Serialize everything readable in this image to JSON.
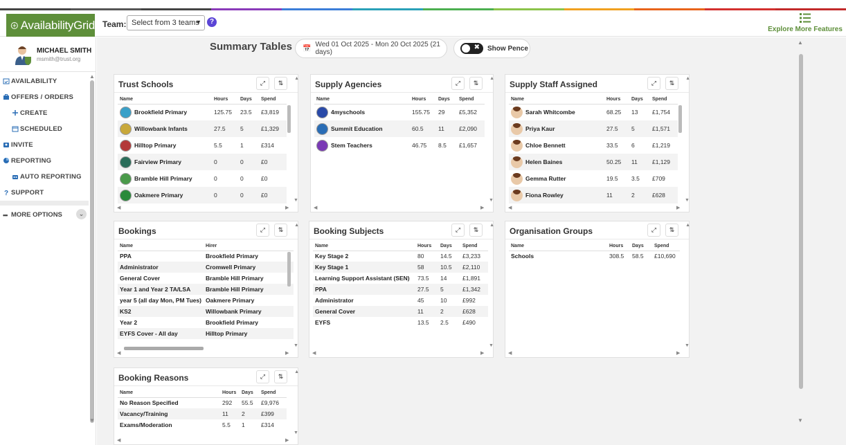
{
  "app": {
    "name": "AvailabilityGrid",
    "rainbow": [
      "#444",
      "#555",
      "#444",
      "#8a3ab9",
      "#3b7dd8",
      "#2aa0b8",
      "#4caf50",
      "#8bc34a",
      "#f0a020",
      "#e8641b",
      "#d3302e",
      "#c22a2a"
    ]
  },
  "header": {
    "team_label": "Team:",
    "team_select": "Select from 3 teams",
    "help": "?",
    "explore": "Explore More Features"
  },
  "user": {
    "name": "MICHAEL SMITH",
    "email": "msmith@trust.org"
  },
  "nav": [
    {
      "label": "AVAILABILITY",
      "icon": "calendar-check-icon",
      "sub": false
    },
    {
      "label": "OFFERS / ORDERS",
      "icon": "briefcase-icon",
      "sub": false
    },
    {
      "label": "CREATE",
      "icon": "plus-icon",
      "sub": true
    },
    {
      "label": "SCHEDULED",
      "icon": "calendar-icon",
      "sub": true
    },
    {
      "label": "INVITE",
      "icon": "invite-icon",
      "sub": false
    },
    {
      "label": "REPORTING",
      "icon": "pie-chart-icon",
      "sub": false
    },
    {
      "label": "AUTO REPORTING",
      "icon": "robot-icon",
      "sub": true
    },
    {
      "label": "SUPPORT",
      "icon": "question-icon",
      "sub": false
    }
  ],
  "more_options": "MORE OPTIONS",
  "main": {
    "title": "Summary Tables",
    "date_range": "Wed 01 Oct 2025 - Mon 20 Oct 2025 (21 days)",
    "pence_label": "Show Pence"
  },
  "panels": {
    "trust_schools": {
      "title": "Trust Schools",
      "cols": [
        "Name",
        "Hours",
        "Days",
        "Spend"
      ],
      "rows": [
        [
          "Brookfield Primary",
          "125.75",
          "23.5",
          "£3,819"
        ],
        [
          "Willowbank Infants",
          "27.5",
          "5",
          "£1,329"
        ],
        [
          "Hilltop Primary",
          "5.5",
          "1",
          "£314"
        ],
        [
          "Fairview Primary",
          "0",
          "0",
          "£0"
        ],
        [
          "Bramble Hill Primary",
          "0",
          "0",
          "£0"
        ],
        [
          "Oakmere Primary",
          "0",
          "0",
          "£0"
        ]
      ]
    },
    "supply_agencies": {
      "title": "Supply Agencies",
      "cols": [
        "Name",
        "Hours",
        "Days",
        "Spend"
      ],
      "rows": [
        [
          "4myschools",
          "155.75",
          "29",
          "£5,352"
        ],
        [
          "Summit Education",
          "60.5",
          "11",
          "£2,090"
        ],
        [
          "Stem Teachers",
          "46.75",
          "8.5",
          "£1,657"
        ]
      ]
    },
    "supply_staff": {
      "title": "Supply Staff Assigned",
      "cols": [
        "Name",
        "Hours",
        "Days",
        "Spend"
      ],
      "rows": [
        [
          "Sarah Whitcombe",
          "68.25",
          "13",
          "£1,754"
        ],
        [
          "Priya Kaur",
          "27.5",
          "5",
          "£1,571"
        ],
        [
          "Chloe Bennett",
          "33.5",
          "6",
          "£1,219"
        ],
        [
          "Helen Baines",
          "50.25",
          "11",
          "£1,129"
        ],
        [
          "Gemma Rutter",
          "19.5",
          "3.5",
          "£709"
        ],
        [
          "Fiona Rowley",
          "11",
          "2",
          "£628"
        ]
      ]
    },
    "bookings": {
      "title": "Bookings",
      "cols": [
        "Name",
        "Hirer"
      ],
      "rows": [
        [
          "PPA",
          "Brookfield Primary"
        ],
        [
          "Administrator",
          "Cromwell Primary"
        ],
        [
          "General Cover",
          "Bramble Hill Primary"
        ],
        [
          "Year 1 and Year 2 TA/LSA",
          "Bramble Hill Primary"
        ],
        [
          "year 5 (all day Mon, PM Tues)",
          "Oakmere Primary"
        ],
        [
          "KS2",
          "Willowbank Primary"
        ],
        [
          "Year 2",
          "Brookfield Primary"
        ],
        [
          "EYFS Cover - All day",
          "Hilltop Primary"
        ]
      ]
    },
    "booking_subjects": {
      "title": "Booking Subjects",
      "cols": [
        "Name",
        "Hours",
        "Days",
        "Spend"
      ],
      "rows": [
        [
          "Key Stage 2",
          "80",
          "14.5",
          "£3,233"
        ],
        [
          "Key Stage 1",
          "58",
          "10.5",
          "£2,110"
        ],
        [
          "Learning Support Assistant (SEN)",
          "73.5",
          "14",
          "£1,891"
        ],
        [
          "PPA",
          "27.5",
          "5",
          "£1,342"
        ],
        [
          "Administrator",
          "45",
          "10",
          "£992"
        ],
        [
          "General Cover",
          "11",
          "2",
          "£628"
        ],
        [
          "EYFS",
          "13.5",
          "2.5",
          "£490"
        ]
      ]
    },
    "organisation_groups": {
      "title": "Organisation Groups",
      "cols": [
        "Name",
        "Hours",
        "Days",
        "Spend"
      ],
      "rows": [
        [
          "Schools",
          "308.5",
          "58.5",
          "£10,690"
        ]
      ]
    },
    "booking_reasons": {
      "title": "Booking Reasons",
      "cols": [
        "Name",
        "Hours",
        "Days",
        "Spend"
      ],
      "rows": [
        [
          "No Reason Specified",
          "292",
          "55.5",
          "£9,976"
        ],
        [
          "Vacancy/Training",
          "11",
          "2",
          "£399"
        ],
        [
          "Exams/Moderation",
          "5.5",
          "1",
          "£314"
        ]
      ]
    }
  }
}
